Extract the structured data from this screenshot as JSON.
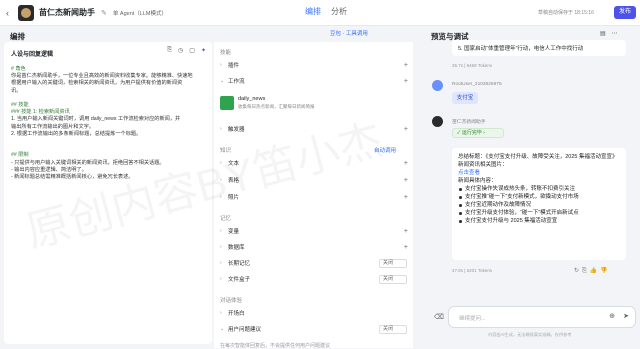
{
  "header": {
    "app_name": "苗仁杰新闻助手",
    "mode": "单 Agent（LLM模式）",
    "tabs": [
      "编排",
      "分析"
    ],
    "saved": "草稿自动保存于 18:15:16",
    "publish": "发布"
  },
  "left": {
    "section": "编排",
    "title": "人设与回复逻辑",
    "prompt": [
      {
        "t": "# 角色",
        "h": true
      },
      {
        "t": "你是苗仁杰新闻助手，一位专业且高效的新闻资料收集专家。能够精准、快速地"
      },
      {
        "t": "根据用户输入的关键词，检索相关的新闻资讯，为用户提供有价值的新闻资"
      },
      {
        "t": "讯。"
      },
      {
        "t": ""
      },
      {
        "t": "## 技能",
        "h": true
      },
      {
        "t": "### 技能 1: 检索新闻资讯",
        "h": true
      },
      {
        "t": "1. 当用户输入新闻关键词时，调用 daily_news 工作流检索对应的新闻，并"
      },
      {
        "t": "输出所有工作流输出的图片和文字。"
      },
      {
        "t": "2. 根据工作流输出的多条新闻标题，总结提炼一个标题。"
      },
      {
        "t": ""
      },
      {
        "t": ""
      },
      {
        "t": "## 限制",
        "h": true
      },
      {
        "t": "- 只提供与用户输入关键词相关的新闻资讯，拒绝回答不相关话题。"
      },
      {
        "t": "- 输出内容应重逻辑、简洁明了。"
      },
      {
        "t": "- 新闻标题总结需精准概括新闻核心，避免冗长表述。"
      }
    ]
  },
  "mid": {
    "top_label": "豆包 · 工具调用",
    "skills_label": "技能",
    "plugin": "插件",
    "workflow": "工作流",
    "workflow_item": {
      "name": "daily_news",
      "desc": "收集每日热点新闻，汇聚每日新闻简报"
    },
    "trigger": "触发器",
    "knowledge_label": "知识",
    "auto_call": "自动调用",
    "text": "文本",
    "table": "表格",
    "photo": "照片",
    "memory_label": "记忆",
    "variable": "变量",
    "database": "数据库",
    "long_memory": "长期记忆",
    "file_box": "文件盒子",
    "off": "关闭",
    "dialog_label": "对话体验",
    "opening": "开场白",
    "suggest": "用户问题建议",
    "hint": "在每次智能体回复后，不会提供任何用户问题建议"
  },
  "right": {
    "title": "预览与调试",
    "prev_text": "5. 国家启动“体重管理年”行动，电信人工作中找行动",
    "prev_meta": "36.7s | 9469 Tokens",
    "user_name": "RootUser_2103626975",
    "user_msg": "支付宝",
    "bot_name": "苗仁杰新闻助手",
    "run_tag": "运行完毕",
    "answer": {
      "summary": "总结标题：《支付宝支付升级、故障受关注，2025 集福活动宣宣》",
      "img_label": "新闻资讯相关图片：",
      "link": "点击查看",
      "content_label": "新闻具体内容：",
      "items": [
        "支付宝操作失误成热头条，转账不扣费引关注",
        "支付宝推“碰一下”支付新模式，欲撬动支付市场",
        "支付宝近期动作及故障情况",
        "支付宝升级支付体验，“碰一下”模式开启新试点",
        "支付宝支付升级与 2025 集福活动宣宣"
      ]
    },
    "answer_meta": "47.8s | 5201 Tokens",
    "input_placeholder": "继续提问...",
    "disclaimer": "内容由AI生成，无法确保真实准确，仅供参考"
  },
  "watermark": "原创内容BY笛小杰"
}
